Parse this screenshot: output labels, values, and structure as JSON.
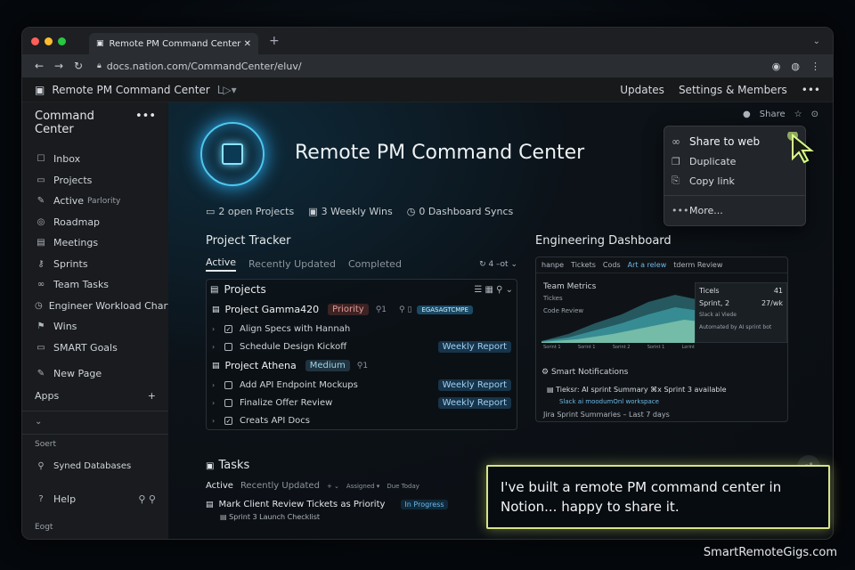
{
  "browser": {
    "tab_title": "Remote PM Command Center",
    "url": "docs.nation.com/CommandCenter/eluv/"
  },
  "topbar": {
    "breadcrumb": "Remote PM Command Center",
    "crumb_extra": "L▷▾",
    "updates": "Updates",
    "settings": "Settings & Members",
    "more": "•••"
  },
  "sidebar": {
    "title": "Command Center",
    "items": [
      {
        "label": "Inbox",
        "icon": "inbox-icon",
        "glyph": "☐"
      },
      {
        "label": "Projects",
        "icon": "folder-icon",
        "glyph": "▭"
      },
      {
        "label": "Active",
        "sub": "Parlority",
        "icon": "edit-icon",
        "glyph": "✎"
      },
      {
        "label": "Roadmap",
        "icon": "target-icon",
        "glyph": "◎"
      },
      {
        "label": "Meetings",
        "icon": "calendar-icon",
        "glyph": "▤"
      },
      {
        "label": "Sprints",
        "icon": "key-icon",
        "glyph": "⚷"
      },
      {
        "label": "Team Tasks",
        "icon": "link-icon",
        "glyph": "∞"
      },
      {
        "label": "Engineer Workload Chart",
        "icon": "clock-icon",
        "glyph": "◷"
      },
      {
        "label": "Wins",
        "icon": "flag-icon",
        "glyph": "⚑"
      },
      {
        "label": "SMART Goals",
        "icon": "folder-icon",
        "glyph": "▭"
      }
    ],
    "new_page": "New Page",
    "apps": "Apps",
    "sort": "Soert",
    "synced": "Syned Databases",
    "help": "Help",
    "edit": "Eogt"
  },
  "page": {
    "title": "Remote PM Command Center",
    "share": "Share",
    "stats": [
      "2 open Projects",
      "3 Weekly Wins",
      "0 Dashboard Syncs"
    ]
  },
  "share_menu": {
    "items": [
      "Share to web",
      "Duplicate",
      "Copy link",
      "More..."
    ]
  },
  "tracker": {
    "title": "Project Tracker",
    "tabs": [
      "Active",
      "Recently Updated",
      "Completed"
    ],
    "tab_right": "↻ 4 –ot ⌄",
    "box_title": "Projects",
    "projects": [
      {
        "name": "Project Gamma420",
        "badge": "Priority",
        "count": "1",
        "code": "EGASAGTCMPE",
        "tasks": [
          {
            "label": "Align Specs with Hannah",
            "checked": true,
            "tag": ""
          },
          {
            "label": "Schedule Design Kickoff",
            "checked": false,
            "tag": "Weekly Report"
          }
        ]
      },
      {
        "name": "Project Athena",
        "badge": "Medium",
        "count": "1",
        "code": "",
        "tasks": [
          {
            "label": "Add API Endpoint Mockups",
            "checked": false,
            "tag": "Weekly Report"
          },
          {
            "label": "Finalize Offer Review",
            "checked": false,
            "tag": "Weekly Report"
          },
          {
            "label": "Creats API Docs",
            "checked": true,
            "tag": ""
          }
        ]
      }
    ]
  },
  "engineering": {
    "title": "Engineering Dashboard",
    "tabs": [
      "hanpe",
      "Tickets",
      "Cods",
      "Art a relew",
      "tderm Review"
    ],
    "metrics_title": "Team Metrics",
    "metric_labels": [
      "Tickes",
      "Code Review"
    ],
    "axis_labels": [
      "Sorint 1",
      "Sorint 1",
      "Sorint 2",
      "Sorint 1",
      "Lorint"
    ],
    "tickets_box": {
      "title": "Ticels",
      "title_val": "41",
      "sprint": "Sprint, 2",
      "sprint_val": "27/wk",
      "slack": "Slack ai Viede",
      "note": "Automated by AI sprint bot"
    },
    "notifications_title": "Smart Notifications",
    "notification": "Tieksr: AI sprint Summary ⌘x Sprint 3 available",
    "notification_link": "Slack ai moodumOnl workspace",
    "jira": "Jira Sprint Summaries – Last 7 days"
  },
  "tasks": {
    "title": "Tasks",
    "tabs": [
      "Active",
      "Recently Updated"
    ],
    "extra": [
      "+ ⌄",
      "Assigned ▾",
      "Due Today"
    ],
    "rows": [
      {
        "label": "Mark Client Review Tickets as Priority",
        "status": "In Progress"
      }
    ],
    "sub_row": "Sprint 3 Launch Checklist"
  },
  "caption": "I've built a remote PM command center in Notion... happy to share it.",
  "watermark": "SmartRemoteGigs.com",
  "colors": {
    "accent": "#4fc8f0",
    "caption_border": "#d5e48a",
    "priority": "#e59b9b"
  }
}
